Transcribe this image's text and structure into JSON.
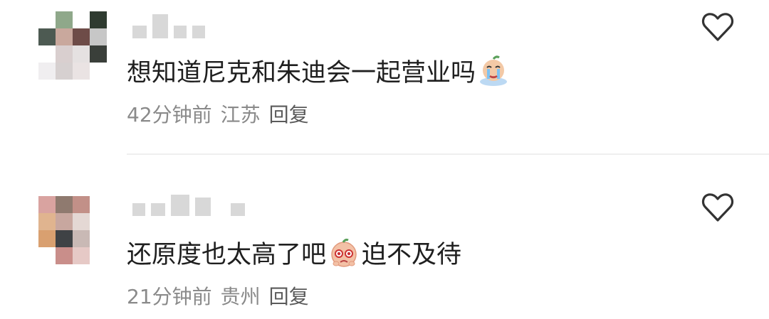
{
  "comments": [
    {
      "text_before": "想知道尼克和朱迪会一起营业吗",
      "text_after": "",
      "emoji": "crying-face-emoji",
      "time": "42分钟前",
      "location": "江苏",
      "reply_label": "回复",
      "avatar_colors": [
        "#ffffff",
        "#8fa88a",
        "#ffffff",
        "#2f3b30",
        "#4d5a52",
        "#c9a89d",
        "#6e4c48",
        "#c7c7c7",
        "#ffffff",
        "#d9cfcf",
        "#e5e1e1",
        "#3a3f3a",
        "#f0eef0",
        "#d6d0d0",
        "#eae3e3",
        "#ffffff"
      ]
    },
    {
      "text_before": "还原度也太高了吧",
      "text_after": "迫不及待",
      "emoji": "pleading-face-emoji",
      "time": "21分钟前",
      "location": "贵州",
      "reply_label": "回复",
      "avatar_colors": [
        "#d9a3a0",
        "#8f7a6f",
        "#c29088",
        "#ffffff",
        "#e0b48f",
        "#c8a79f",
        "#e4d8d4",
        "#ffffff",
        "#d9a070",
        "#3f4245",
        "#c9b9b5",
        "#ffffff",
        "#ffffff",
        "#c98e8a",
        "#e6c9c6",
        "#ffffff"
      ]
    }
  ],
  "colors": {
    "text": "#1f1f1f",
    "meta": "#8a8a8a",
    "heart_stroke": "#333333",
    "divider": "#efefef"
  }
}
